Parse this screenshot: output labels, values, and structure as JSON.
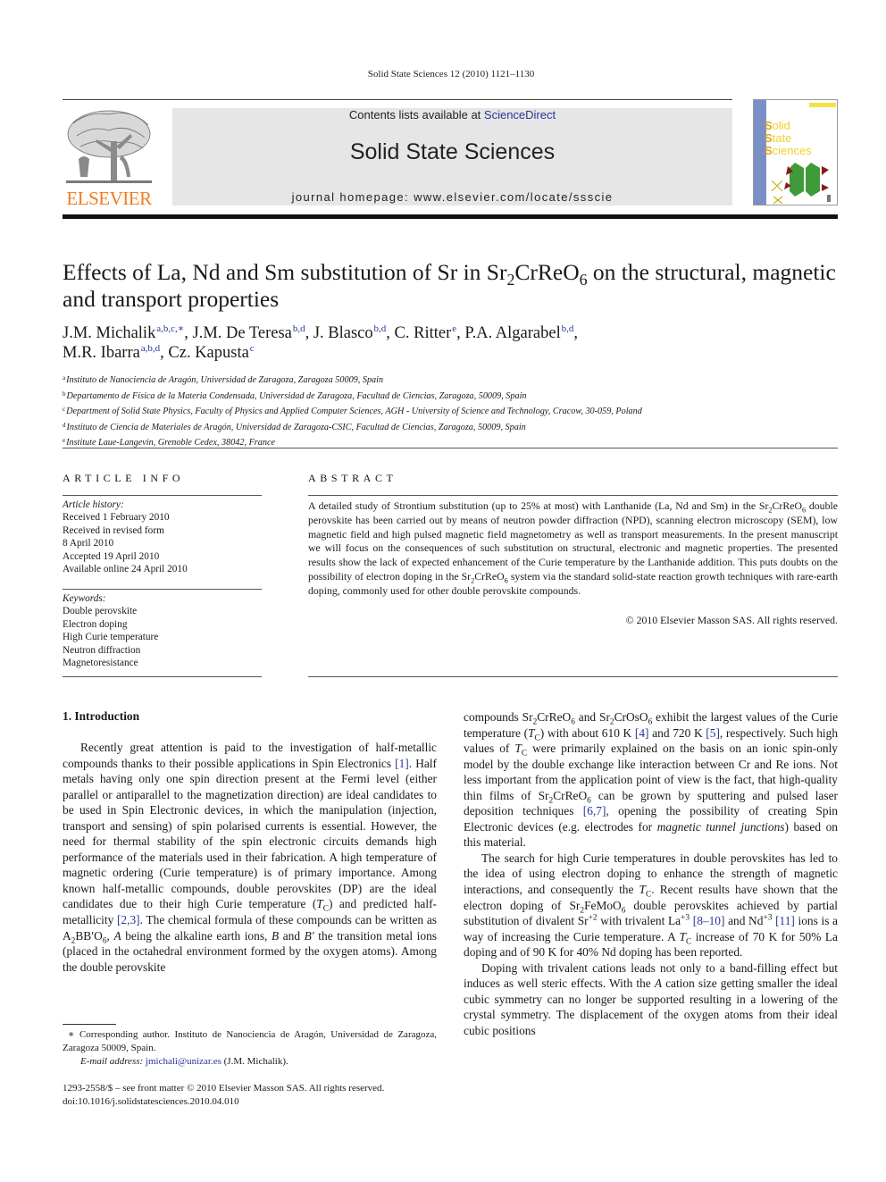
{
  "header": {
    "running_head": "Solid State Sciences 12 (2010) 1121–1130",
    "contents_prefix": "Contents lists available at ",
    "contents_link": "ScienceDirect",
    "journal_title": "Solid State Sciences",
    "homepage_line": "journal homepage: www.elsevier.com/locate/ssscie",
    "publisher_logo_text": "ELSEVIER",
    "logo_icon": "elsevier-tree-icon",
    "cover_words": [
      "Solid",
      "State",
      "Sciences"
    ],
    "colors": {
      "publisher_orange": "#f07c1e",
      "link_blue": "#2b3595",
      "masthead_gray": "#e6e6e6",
      "cover_band": "#7b8fc7",
      "cover_yellow": "#f2cf2a"
    }
  },
  "article": {
    "title_part1": "Effects of La, Nd and Sm substitution of Sr in Sr",
    "title_sub1": "2",
    "title_part2": "CrReO",
    "title_sub2": "6",
    "title_part3": " on the structural, magnetic and transport properties",
    "authors": [
      {
        "name": "J.M. Michalik",
        "affils": "a,b,c,",
        "corresponding": "∗",
        "sep": ", "
      },
      {
        "name": "J.M. De Teresa",
        "affils": "b,d",
        "sep": ", "
      },
      {
        "name": "J. Blasco",
        "affils": "b,d",
        "sep": ", "
      },
      {
        "name": "C. Ritter",
        "affils": "e",
        "sep": ", "
      },
      {
        "name": "P.A. Algarabel",
        "affils": "b,d",
        "sep": ","
      },
      {
        "name": "M.R. Ibarra",
        "affils": "a,b,d",
        "sep": ", "
      },
      {
        "name": "Cz. Kapusta",
        "affils": "c",
        "sep": ""
      }
    ],
    "affiliations": [
      {
        "mark": "a",
        "text": "Instituto de Nanociencia de Aragón, Universidad de Zaragoza, Zaragoza 50009, Spain"
      },
      {
        "mark": "b",
        "text": "Departamento de Física de la Materia Condensada, Universidad de Zaragoza, Facultad de Ciencias, Zaragoza, 50009, Spain"
      },
      {
        "mark": "c",
        "text": "Department of Solid State Physics, Faculty of Physics and Applied Computer Sciences, AGH - University of Science and Technology, Cracow, 30-059, Poland"
      },
      {
        "mark": "d",
        "text": "Instituto de Ciencia de Materiales de Aragón, Universidad de Zaragoza-CSIC, Facultad de Ciencias, Zaragoza, 50009, Spain"
      },
      {
        "mark": "e",
        "text": "Institute Laue-Langevin, Grenoble Cedex, 38042, France"
      }
    ]
  },
  "article_info": {
    "heading": "ARTICLE INFO",
    "history_label": "Article history:",
    "history": [
      "Received 1 February 2010",
      "Received in revised form",
      "8 April 2010",
      "Accepted 19 April 2010",
      "Available online 24 April 2010"
    ],
    "keywords_label": "Keywords:",
    "keywords": [
      "Double perovskite",
      "Electron doping",
      "High Curie temperature",
      "Neutron diffraction",
      "Magnetoresistance"
    ]
  },
  "abstract": {
    "heading": "ABSTRACT",
    "t1": "A detailed study of Strontium substitution (up to 25% at most) with Lanthanide (La, Nd and Sm) in the Sr",
    "t2": "CrReO",
    "t3": " double perovskite has been carried out by means of neutron powder diffraction (NPD), scanning electron microscopy (SEM), low magnetic field and high pulsed magnetic field magnetometry as well as transport measurements. In the present manuscript we will focus on the consequences of such substitution on structural, electronic and magnetic properties. The presented results show the lack of expected enhancement of the Curie temperature by the Lanthanide addition. This puts doubts on the possibility of electron doping in the Sr",
    "t4": "CrReO",
    "t5": " system via the standard solid-state reaction growth techniques with rare-earth doping, commonly used for other double perovskite compounds.",
    "sub2": "2",
    "sub6": "6",
    "copyright": "© 2010 Elsevier Masson SAS. All rights reserved."
  },
  "body": {
    "section_heading": "1.  Introduction",
    "left": {
      "p1a": "Recently great attention is paid to the investigation of half-metallic compounds thanks to their possible applications in Spin Electronics ",
      "ref1": "[1]",
      "p1b": ". Half metals having only one spin direction present at the Fermi level (either parallel or antiparallel to the magnetization direction) are ideal candidates to be used in Spin Electronic devices, in which the manipulation (injection, transport and sensing) of spin polarised currents is essential. However, the need for thermal stability of the spin electronic circuits demands high performance of the materials used in their fabrication. A high temperature of magnetic ordering (Curie temperature) is of primary importance. Among known half-metallic compounds, double perovskites (DP) are the ideal candidates due to their high Curie temperature (",
      "tc": "T",
      "tc_sub": "C",
      "p1c": ") and predicted half-metallicity ",
      "ref23": "[2,3]",
      "p1d": ". The chemical formula of these compounds can be written as A",
      "p1e": "BB′O",
      "p1f": ", ",
      "a_it": "A",
      "p1g": " being the alkaline earth ions, ",
      "b_it": "B",
      "p1h": " and ",
      "bp_it": "B′",
      "p1i": " the transition metal ions (placed in the octahedral environment formed by the oxygen atoms). Among the double perovskite"
    },
    "right": {
      "p1a": "compounds Sr",
      "p1b": "CrReO",
      "p1c": " and Sr",
      "p1d": "CrOsO",
      "p1e": " exhibit the largest values of the Curie temperature (",
      "p1f": ") with about 610 K ",
      "ref4": "[4]",
      "p1g": " and 720 K ",
      "ref5": "[5]",
      "p1h": ", respectively. Such high values of ",
      "p1i": " were primarily explained on the basis on an ionic spin-only model by the double exchange like interaction between Cr and Re ions. Not less important from the application point of view is the fact, that high-quality thin films of Sr",
      "p1j": "CrReO",
      "p1k": " can be grown by sputtering and pulsed laser deposition techniques ",
      "ref67": "[6,7]",
      "p1l": ", opening the possibility of creating Spin Electronic devices (e.g. electrodes for ",
      "p1m": "magnetic tunnel junctions",
      "p1n": ") based on this material.",
      "p2a": "The search for high Curie temperatures in double perovskites has led to the idea of using electron doping to enhance the strength of magnetic interactions, and consequently the ",
      "p2b": ". Recent results have shown that the electron doping of Sr",
      "p2c": "FeMoO",
      "p2d": " double perovskites achieved by partial substitution of divalent Sr",
      "sup2": "+2",
      "p2e": " with trivalent La",
      "sup3": "+3",
      "ref810": "[8–10]",
      "p2f": " and Nd",
      "ref11": "[11]",
      "p2g": " ions is a way of increasing the Curie temperature. A ",
      "p2h": " increase of 70 K for 50% La doping and of 90 K for 40% Nd doping has been reported.",
      "p3": "Doping with trivalent cations leads not only to a band-filling effect but induces as well steric effects. With the ",
      "p3_a": "A",
      "p3b": " cation size getting smaller the ideal cubic symmetry can no longer be supported resulting in a lowering of the crystal symmetry. The displacement of the oxygen atoms from their ideal cubic positions"
    }
  },
  "footnote": {
    "star": "∗",
    "text": " Corresponding author. Instituto de Nanociencia de Aragón, Universidad de Zaragoza, Zaragoza 50009, Spain.",
    "email_label": "E-mail address: ",
    "email": "jmichali@unizar.es",
    "email_suffix": " (J.M. Michalik)."
  },
  "front_matter": {
    "issn_line": "1293-2558/$ – see front matter © 2010 Elsevier Masson SAS. All rights reserved.",
    "doi": "doi:10.1016/j.solidstatesciences.2010.04.010"
  }
}
